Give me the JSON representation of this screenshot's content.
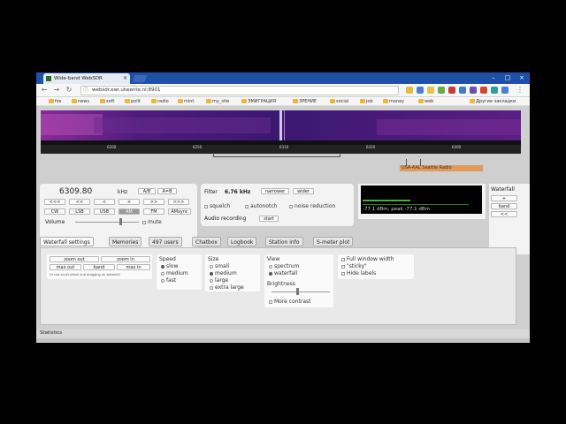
{
  "browser": {
    "tab_title": "Wide-band WebSDR",
    "url": "websdr.ewi.utwente.nl:8901",
    "bookmarks": [
      "fox",
      "news",
      "soft",
      "polit",
      "radio",
      "mint",
      "my_site",
      "ЭМИГРАЦИЯ",
      "ЗРЕНИЕ",
      "social",
      "job",
      "money",
      "web",
      "Другие закладки"
    ]
  },
  "waterfall": {
    "ticks": [
      "6200",
      "6250",
      "6310",
      "6350",
      "6400"
    ],
    "marker_label": "USA-AAL Seattle Radio"
  },
  "tuner": {
    "frequency": "6309.80",
    "unit": "kHz",
    "ab": [
      "A/B",
      "A=B"
    ],
    "step_buttons": [
      "<<<",
      "<<",
      "<",
      "+",
      ">>",
      ">>>"
    ],
    "modes": [
      "CW",
      "LSB",
      "USB",
      "AM",
      "FM",
      "AMsync"
    ],
    "selected_mode": "AM",
    "volume_label": "Volume",
    "mute_label": "mute"
  },
  "filter": {
    "label": "Filter",
    "value": "6.76 kHz",
    "narrower": "narrower",
    "wider": "wider",
    "squelch": "squelch",
    "autonotch": "autonotch",
    "noise_reduction": "noise reduction",
    "audio_recording": "Audio recording",
    "start": "start"
  },
  "smeter": {
    "reading": "-77.1 dBm; peak  -77.1 dBm"
  },
  "wfright": {
    "label": "Waterfall",
    "btn1": "+",
    "btn2": "band",
    "btn3": "<<"
  },
  "tabs": [
    "Waterfall settings",
    "Memories",
    "497 users",
    "Chatbox",
    "Logbook",
    "Station info",
    "S-meter plot"
  ],
  "settings": {
    "zoom_out": "zoom out",
    "zoom_in": "zoom in",
    "max_out": "max out",
    "band": "band",
    "max_in": "max in",
    "hint": "Or use scroll wheel and dragging on waterfall",
    "speed_label": "Speed",
    "speed": [
      "slow",
      "medium",
      "fast"
    ],
    "size_label": "Size",
    "size": [
      "small",
      "medium",
      "large",
      "extra large"
    ],
    "view_label": "View",
    "view": [
      "spectrum",
      "waterfall"
    ],
    "brightness_label": "Brightness",
    "more_contrast": "More contrast",
    "full_window": "Full window width",
    "sticky": "\"sticky\"",
    "hide_labels": "Hide labels"
  },
  "status": {
    "label": "Statistics"
  }
}
